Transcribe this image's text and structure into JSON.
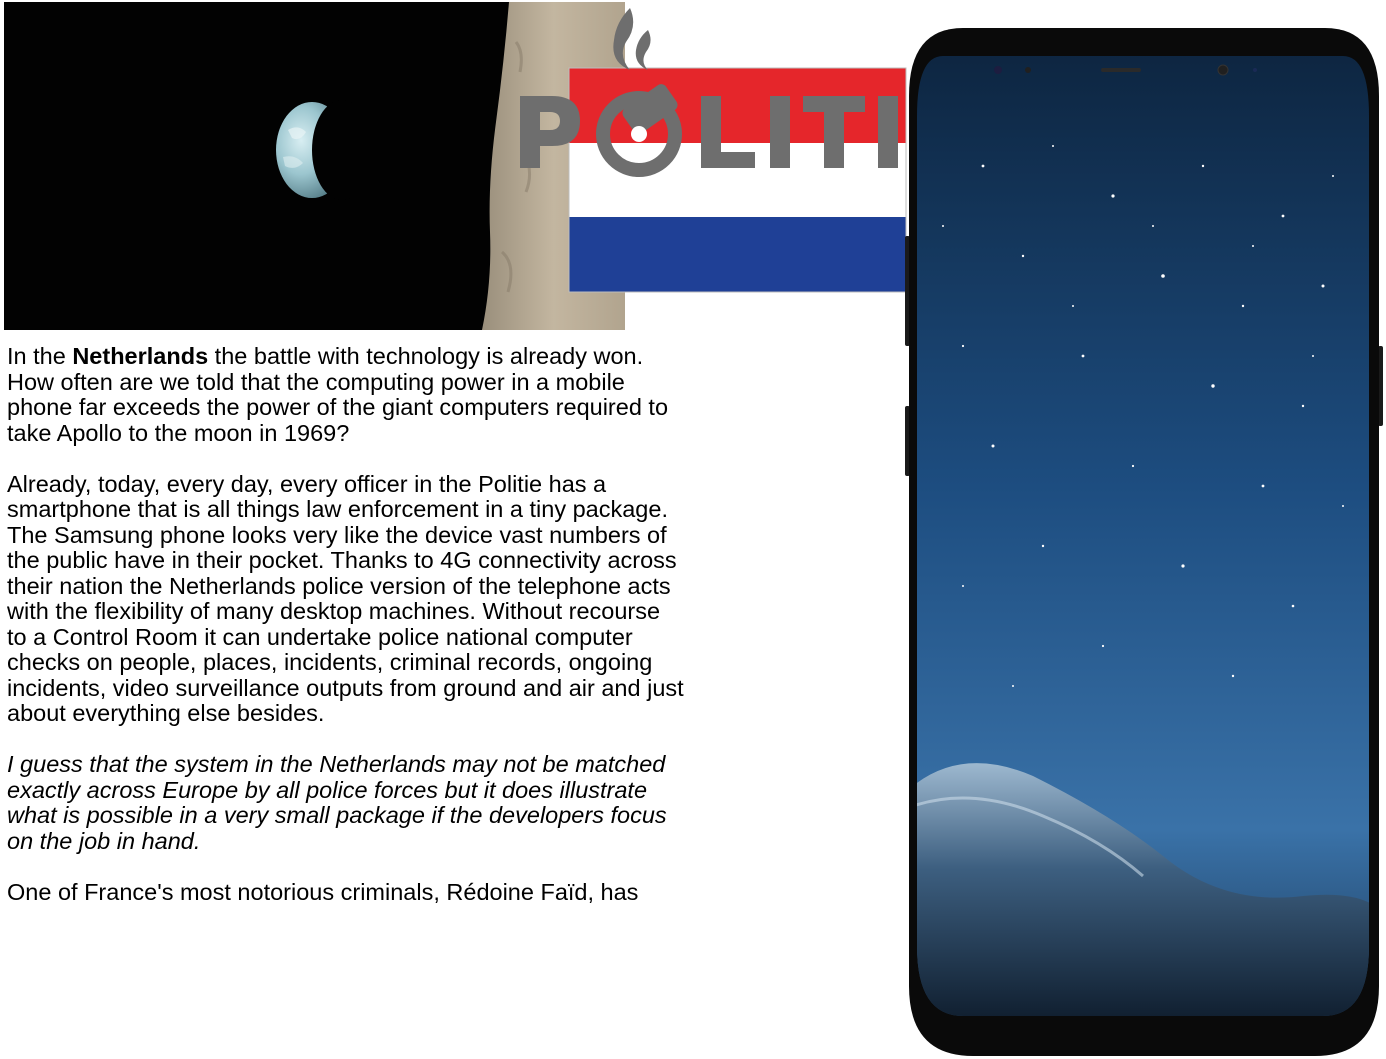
{
  "logo": {
    "wordmark": "POLITIE",
    "colors": {
      "flag_red": "#e5262b",
      "flag_white": "#ffffff",
      "flag_blue": "#1f4096",
      "wordmark_gray": "#6e6e6e"
    }
  },
  "article": {
    "paragraph1": {
      "lead": "In the ",
      "bold": "Netherlands",
      "line1_rest": " the battle with technology is already won.",
      "lines": [
        "How often are we told that the computing power in a mobile",
        "phone far exceeds the power of the giant computers required to",
        "take Apollo to the moon in 1969?"
      ]
    },
    "paragraph2": {
      "lines": [
        "Already, today, every day, every officer in the Politie has a",
        "smartphone that is all things law enforcement in a tiny package.",
        "The Samsung phone looks very like the device vast numbers of",
        "the public have in their pocket. Thanks to 4G connectivity across",
        "their nation the Netherlands police version of the telephone acts",
        "with the flexibility of many desktop machines. Without recourse",
        "to a Control Room  it can undertake police national computer",
        "checks on people, places, incidents, criminal records, ongoing",
        "incidents, video surveillance outputs from ground and air and just",
        "about everything else besides."
      ]
    },
    "paragraph3": {
      "lines": [
        "I guess that the system in the Netherlands may not be matched",
        "exactly across Europe by all police forces but it does illustrate",
        "what is possible in a very small package if the developers focus",
        "on the job in hand."
      ]
    },
    "paragraph4": {
      "lines": [
        "One of France's most notorious criminals, Rédoine Faïd, has"
      ]
    }
  }
}
